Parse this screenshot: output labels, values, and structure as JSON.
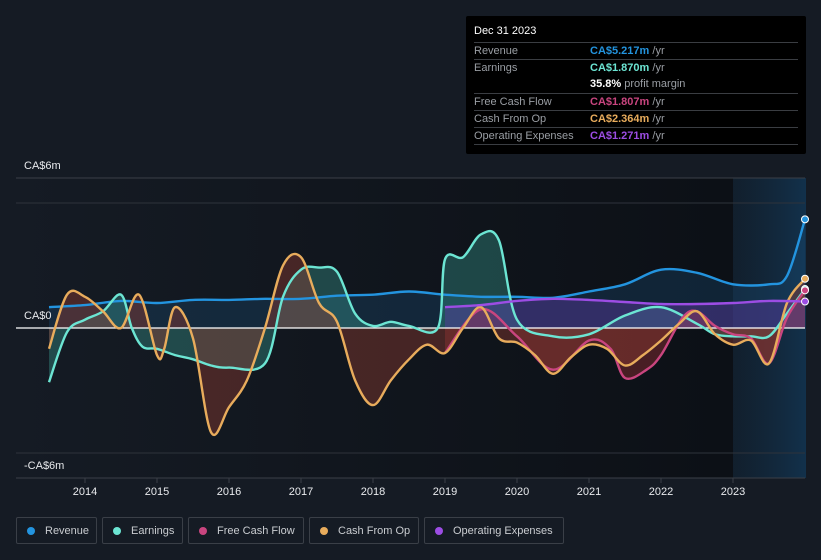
{
  "tooltip": {
    "date": "Dec 31 2023",
    "rows": [
      {
        "label": "Revenue",
        "value": "CA$5.217m",
        "unit": " /yr",
        "color": "#2394df"
      },
      {
        "label": "Earnings",
        "value": "CA$1.870m",
        "unit": " /yr",
        "color": "#6ce5d3"
      },
      {
        "label": "",
        "value": "35.8%",
        "unit": " profit margin",
        "color": "#ffffff"
      },
      {
        "label": "Free Cash Flow",
        "value": "CA$1.807m",
        "unit": " /yr",
        "color": "#c9457f"
      },
      {
        "label": "Cash From Op",
        "value": "CA$2.364m",
        "unit": " /yr",
        "color": "#e8ac5c"
      },
      {
        "label": "Operating Expenses",
        "value": "CA$1.271m",
        "unit": " /yr",
        "color": "#9c4de4"
      }
    ]
  },
  "legend": [
    {
      "label": "Revenue",
      "color": "#2394df"
    },
    {
      "label": "Earnings",
      "color": "#6ce5d3"
    },
    {
      "label": "Free Cash Flow",
      "color": "#c9457f"
    },
    {
      "label": "Cash From Op",
      "color": "#e8ac5c"
    },
    {
      "label": "Operating Expenses",
      "color": "#9c4de4"
    }
  ],
  "chart_data": {
    "type": "line",
    "title": "",
    "xlabel": "",
    "ylabel": "",
    "ylim": [
      -6,
      6
    ],
    "y_unit": "CA$m",
    "y_tick_labels": [
      "CA$6m",
      "CA$0",
      "-CA$6m"
    ],
    "y_ticks": [
      6,
      0,
      -6
    ],
    "x_ticks": [
      2014,
      2015,
      2016,
      2017,
      2018,
      2019,
      2020,
      2021,
      2022,
      2023
    ],
    "xlim": [
      2013.5,
      2024.0
    ],
    "forecast_shade_start": 2023.0,
    "grid": true,
    "legend_position": "bottom",
    "series": [
      {
        "name": "Revenue",
        "color": "#2394df",
        "x": [
          2013.5,
          2014.0,
          2014.5,
          2015.0,
          2015.5,
          2016.0,
          2016.5,
          2017.0,
          2017.5,
          2018.0,
          2018.5,
          2019.0,
          2019.5,
          2020.0,
          2020.5,
          2021.0,
          2021.5,
          2022.0,
          2022.5,
          2023.0,
          2023.5,
          2023.75,
          2024.0
        ],
        "y": [
          1.0,
          1.1,
          1.3,
          1.2,
          1.35,
          1.35,
          1.4,
          1.4,
          1.55,
          1.6,
          1.75,
          1.6,
          1.5,
          1.5,
          1.45,
          1.75,
          2.1,
          2.8,
          2.65,
          2.1,
          2.1,
          2.5,
          5.217
        ]
      },
      {
        "name": "Earnings",
        "color": "#6ce5d3",
        "x": [
          2013.5,
          2013.75,
          2014.0,
          2014.25,
          2014.5,
          2014.65,
          2014.8,
          2015.0,
          2015.25,
          2015.5,
          2015.75,
          2016.0,
          2016.5,
          2016.75,
          2017.0,
          2017.25,
          2017.5,
          2017.75,
          2018.0,
          2018.25,
          2018.5,
          2018.9,
          2019.0,
          2019.25,
          2019.5,
          2019.75,
          2020.0,
          2020.5,
          2021.0,
          2021.5,
          2022.0,
          2022.5,
          2022.75,
          2023.0,
          2023.25,
          2023.5,
          2023.75,
          2024.0
        ],
        "y": [
          -2.6,
          -0.2,
          0.4,
          0.8,
          1.6,
          0.0,
          -0.9,
          -1.0,
          -1.3,
          -1.5,
          -1.8,
          -1.9,
          -1.7,
          1.5,
          2.8,
          2.9,
          2.7,
          0.7,
          0.1,
          0.3,
          0.1,
          0.0,
          3.3,
          3.4,
          4.5,
          4.2,
          0.4,
          -0.4,
          -0.3,
          0.6,
          1.0,
          0.2,
          -0.3,
          -0.4,
          -0.4,
          -0.4,
          0.7,
          1.87
        ]
      },
      {
        "name": "Free Cash Flow",
        "color": "#c9457f",
        "x": [
          2019.0,
          2019.5,
          2020.0,
          2020.5,
          2021.0,
          2021.3,
          2021.5,
          2021.8,
          2022.0,
          2022.3,
          2022.5,
          2022.75,
          2023.0,
          2023.25,
          2023.5,
          2023.75,
          2024.0
        ],
        "y": [
          -1.2,
          0.9,
          -0.4,
          -2.0,
          -0.6,
          -1.0,
          -2.4,
          -2.0,
          -1.3,
          0.5,
          0.8,
          0.1,
          -0.3,
          -0.5,
          -1.7,
          0.5,
          1.807
        ]
      },
      {
        "name": "Cash From Op",
        "color": "#e8ac5c",
        "x": [
          2013.5,
          2013.75,
          2014.0,
          2014.25,
          2014.5,
          2014.75,
          2015.0,
          2015.1,
          2015.25,
          2015.5,
          2015.75,
          2016.0,
          2016.25,
          2016.5,
          2016.75,
          2017.0,
          2017.25,
          2017.5,
          2017.75,
          2018.0,
          2018.25,
          2018.5,
          2018.75,
          2019.0,
          2019.25,
          2019.5,
          2019.75,
          2020.0,
          2020.25,
          2020.5,
          2020.75,
          2021.0,
          2021.25,
          2021.5,
          2021.75,
          2022.0,
          2022.25,
          2022.5,
          2022.75,
          2023.0,
          2023.25,
          2023.5,
          2023.75,
          2024.0
        ],
        "y": [
          -1.0,
          1.6,
          1.5,
          0.8,
          0.0,
          1.6,
          -1.3,
          -1.0,
          1.0,
          -0.5,
          -5.0,
          -3.8,
          -2.5,
          0.0,
          3.0,
          3.4,
          1.2,
          0.3,
          -2.5,
          -3.7,
          -2.5,
          -1.5,
          -0.8,
          -1.2,
          0.0,
          1.0,
          -0.5,
          -0.7,
          -1.3,
          -2.2,
          -1.4,
          -0.8,
          -1.0,
          -1.8,
          -1.3,
          -0.6,
          0.2,
          0.8,
          -0.3,
          -0.8,
          -0.6,
          -1.7,
          1.2,
          2.364
        ]
      },
      {
        "name": "Operating Expenses",
        "color": "#9c4de4",
        "x": [
          2019.0,
          2019.5,
          2020.0,
          2020.5,
          2021.0,
          2021.5,
          2022.0,
          2022.5,
          2023.0,
          2023.5,
          2024.0
        ],
        "y": [
          1.0,
          1.1,
          1.3,
          1.4,
          1.35,
          1.25,
          1.15,
          1.15,
          1.2,
          1.3,
          1.271
        ]
      }
    ]
  }
}
